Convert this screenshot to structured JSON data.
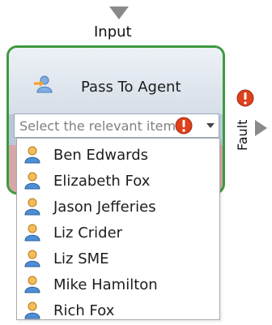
{
  "workflow": {
    "input_port_label": "Input",
    "fault_port_label": "Fault"
  },
  "activity": {
    "title": "Pass To Agent",
    "icon": "agent-transfer-icon",
    "border_color": "#3f9b3f"
  },
  "agent_select": {
    "placeholder": "Select the relevant item",
    "icons": {
      "error": "error-icon",
      "dropdown": "chevron-down-icon"
    },
    "options": [
      {
        "label": "Ben Edwards",
        "icon": "user-icon"
      },
      {
        "label": "Elizabeth Fox",
        "icon": "user-icon"
      },
      {
        "label": "Jason Jefferies",
        "icon": "user-icon"
      },
      {
        "label": "Liz Crider",
        "icon": "user-icon"
      },
      {
        "label": "Liz SME",
        "icon": "user-icon"
      },
      {
        "label": "Mike Hamilton",
        "icon": "user-icon"
      },
      {
        "label": "Rich Fox",
        "icon": "user-icon"
      }
    ]
  },
  "colors": {
    "error_red": "#e0401c",
    "port_gray": "#8a8a8a",
    "placeholder_gray": "#808080"
  }
}
